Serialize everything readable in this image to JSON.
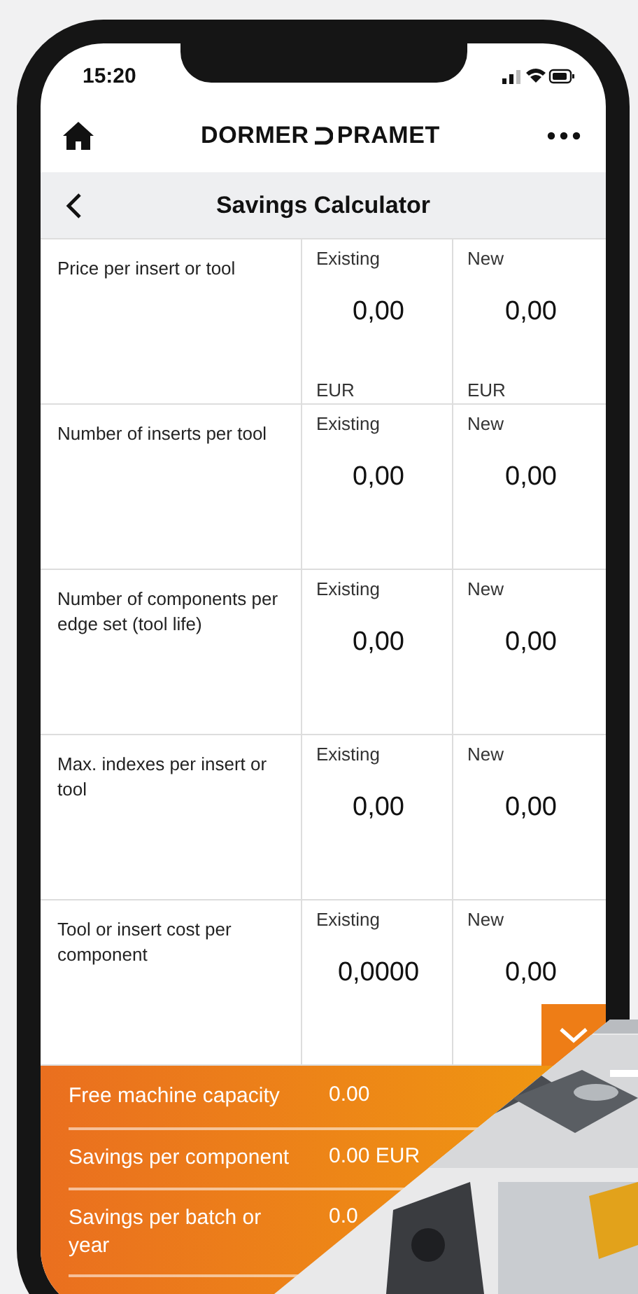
{
  "status_bar": {
    "time": "15:20"
  },
  "header": {
    "logo_left": "DORMER",
    "logo_right": "PRAMET"
  },
  "title_bar": {
    "title": "Savings Calculator"
  },
  "rows": [
    {
      "label": "Price per insert or tool",
      "existing": {
        "caption": "Existing",
        "value": "0,00",
        "unit": "EUR"
      },
      "new": {
        "caption": "New",
        "value": "0,00",
        "unit": "EUR"
      }
    },
    {
      "label": "Number of inserts per tool",
      "existing": {
        "caption": "Existing",
        "value": "0,00"
      },
      "new": {
        "caption": "New",
        "value": "0,00"
      }
    },
    {
      "label": "Number of components per edge set (tool life)",
      "existing": {
        "caption": "Existing",
        "value": "0,00"
      },
      "new": {
        "caption": "New",
        "value": "0,00"
      }
    },
    {
      "label": "Max. indexes per insert or tool",
      "existing": {
        "caption": "Existing",
        "value": "0,00"
      },
      "new": {
        "caption": "New",
        "value": "0,00"
      }
    },
    {
      "label": "Tool or insert cost per component",
      "existing": {
        "caption": "Existing",
        "value": "0,0000"
      },
      "new": {
        "caption": "New",
        "value": "0,00"
      }
    }
  ],
  "results": [
    {
      "label": "Free machine capacity",
      "value": "0.00"
    },
    {
      "label": "Savings per component",
      "value": "0.00 EUR"
    },
    {
      "label": "Savings per batch or year",
      "value": "0.0"
    }
  ]
}
